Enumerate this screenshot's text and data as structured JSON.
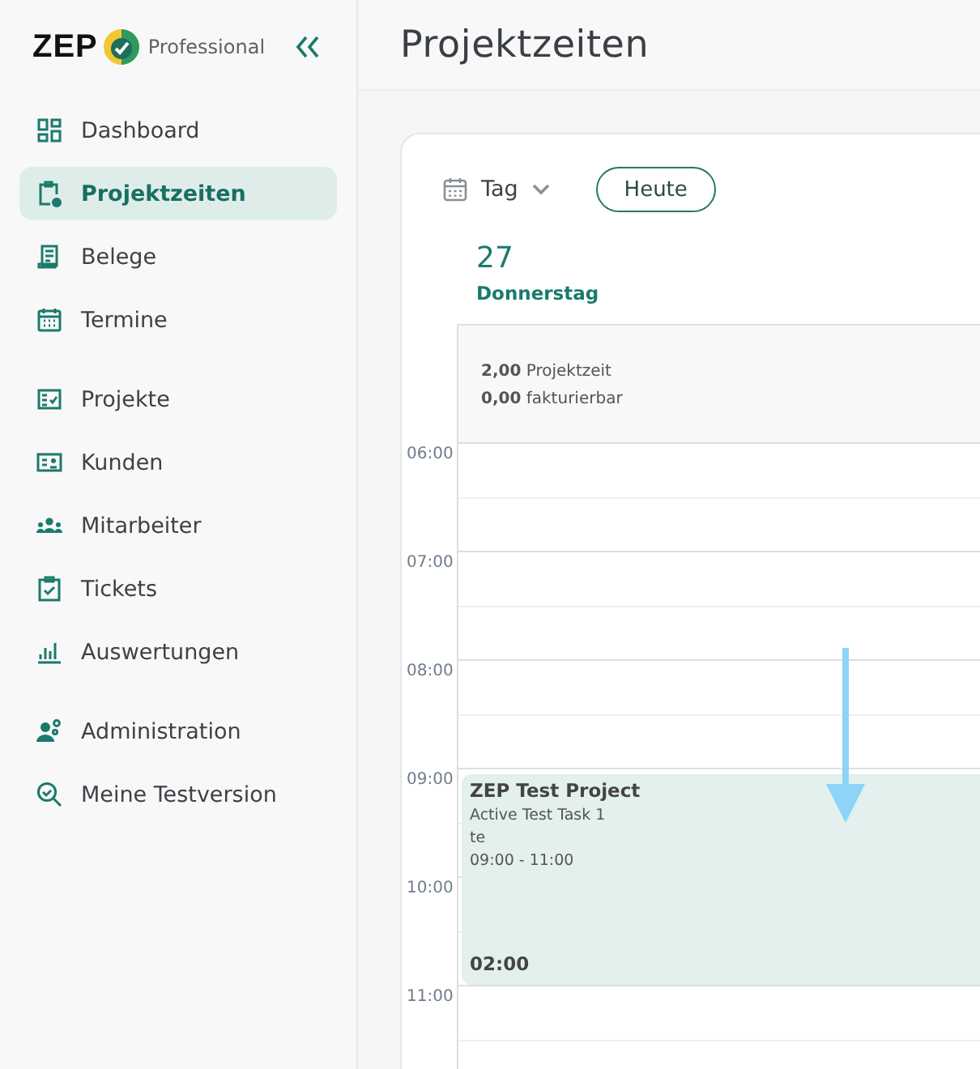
{
  "app": {
    "logo": "ZEP",
    "edition": "Professional"
  },
  "sidebar": {
    "groups": [
      [
        {
          "label": "Dashboard",
          "selected": false
        },
        {
          "label": "Projektzeiten",
          "selected": true
        },
        {
          "label": "Belege",
          "selected": false
        },
        {
          "label": "Termine",
          "selected": false
        }
      ],
      [
        {
          "label": "Projekte",
          "selected": false
        },
        {
          "label": "Kunden",
          "selected": false
        },
        {
          "label": "Mitarbeiter",
          "selected": false
        },
        {
          "label": "Tickets",
          "selected": false
        },
        {
          "label": "Auswertungen",
          "selected": false
        }
      ],
      [
        {
          "label": "Administration",
          "selected": false
        },
        {
          "label": "Meine Testversion",
          "selected": false
        }
      ]
    ]
  },
  "page": {
    "title": "Projektzeiten"
  },
  "calendar": {
    "view": "Tag",
    "today_button": "Heute",
    "day_number": "27",
    "weekday": "Donnerstag",
    "summary": [
      "**2,00** Projektzeit",
      "**0,00** fakturierbar"
    ],
    "hours": [
      {
        "label": "06:00"
      },
      {
        "label": "07:00"
      },
      {
        "label": "08:00"
      },
      {
        "label": "09:00",
        "event": {
          "title": "ZEP Test Project",
          "task": "Active Test Task 1",
          "note": "te",
          "time": "09:00 - 11:00",
          "duration": "02:00"
        }
      },
      {
        "label": "10:00"
      },
      {
        "label": "11:00"
      }
    ]
  },
  "annotation": {
    "kind": "arrow"
  }
}
